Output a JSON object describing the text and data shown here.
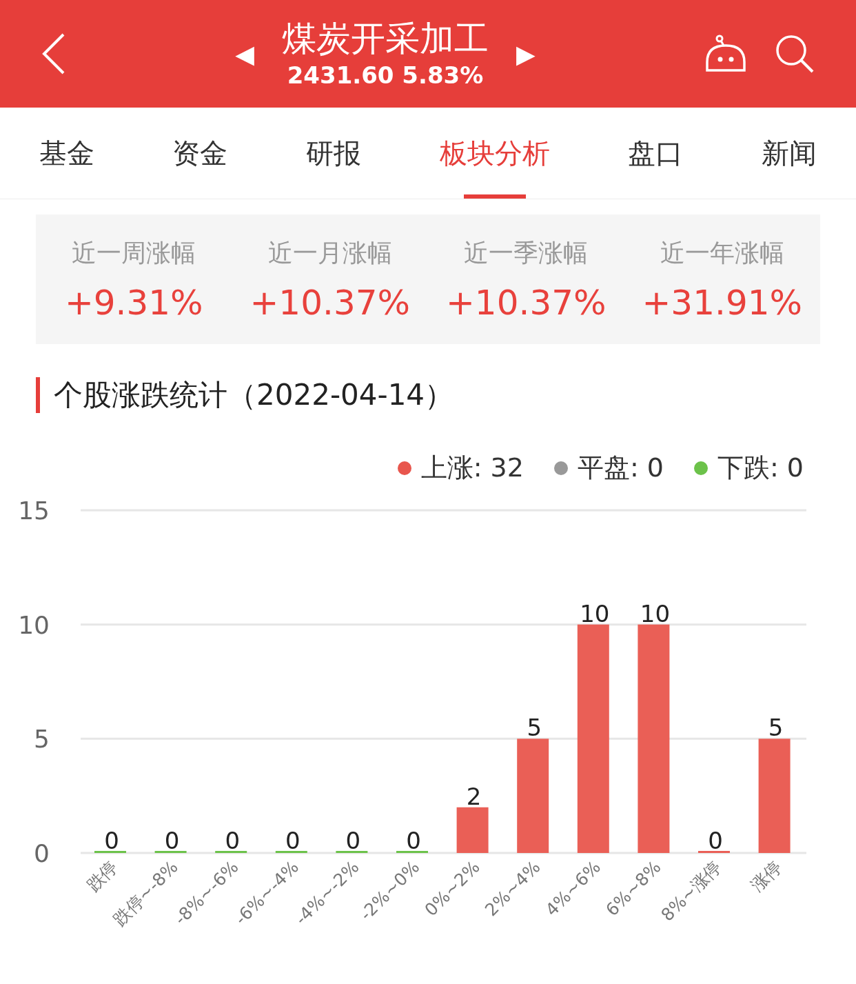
{
  "header": {
    "title": "煤炭开采加工",
    "subtitle": "2431.60 5.83%",
    "prev": "◀",
    "next": "▶"
  },
  "tabs": [
    {
      "label": "基金",
      "selected": false
    },
    {
      "label": "资金",
      "selected": false
    },
    {
      "label": "研报",
      "selected": false
    },
    {
      "label": "板块分析",
      "selected": true
    },
    {
      "label": "盘口",
      "selected": false
    },
    {
      "label": "新闻",
      "selected": false
    }
  ],
  "stats": [
    {
      "label": "近一周涨幅",
      "value": "+9.31%"
    },
    {
      "label": "近一月涨幅",
      "value": "+10.37%"
    },
    {
      "label": "近一季涨幅",
      "value": "+10.37%"
    },
    {
      "label": "近一年涨幅",
      "value": "+31.91%"
    }
  ],
  "section_title": "个股涨跌统计（2022-04-14）",
  "legend": [
    {
      "label": "上涨: 32",
      "color": "#e8564d"
    },
    {
      "label": "平盘: 0",
      "color": "#999999"
    },
    {
      "label": "下跌: 0",
      "color": "#6cc24a"
    }
  ],
  "chart_data": {
    "type": "bar",
    "categories": [
      "跌停",
      "跌停~-8%",
      "-8%~-6%",
      "-6%~-4%",
      "-4%~-2%",
      "-2%~0%",
      "0%~2%",
      "2%~4%",
      "4%~6%",
      "6%~8%",
      "8%~涨停",
      "涨停"
    ],
    "series": [
      {
        "color": "#6cc24a",
        "values": [
          0,
          0,
          0,
          0,
          0,
          0,
          null,
          null,
          null,
          null,
          null,
          null
        ]
      },
      {
        "color": "#ea5f56",
        "values": [
          null,
          null,
          null,
          null,
          null,
          null,
          2,
          5,
          10,
          10,
          0,
          5
        ]
      }
    ],
    "ylim": [
      0,
      15
    ],
    "yticks": [
      0,
      5,
      10,
      15
    ],
    "data_labels": true
  }
}
